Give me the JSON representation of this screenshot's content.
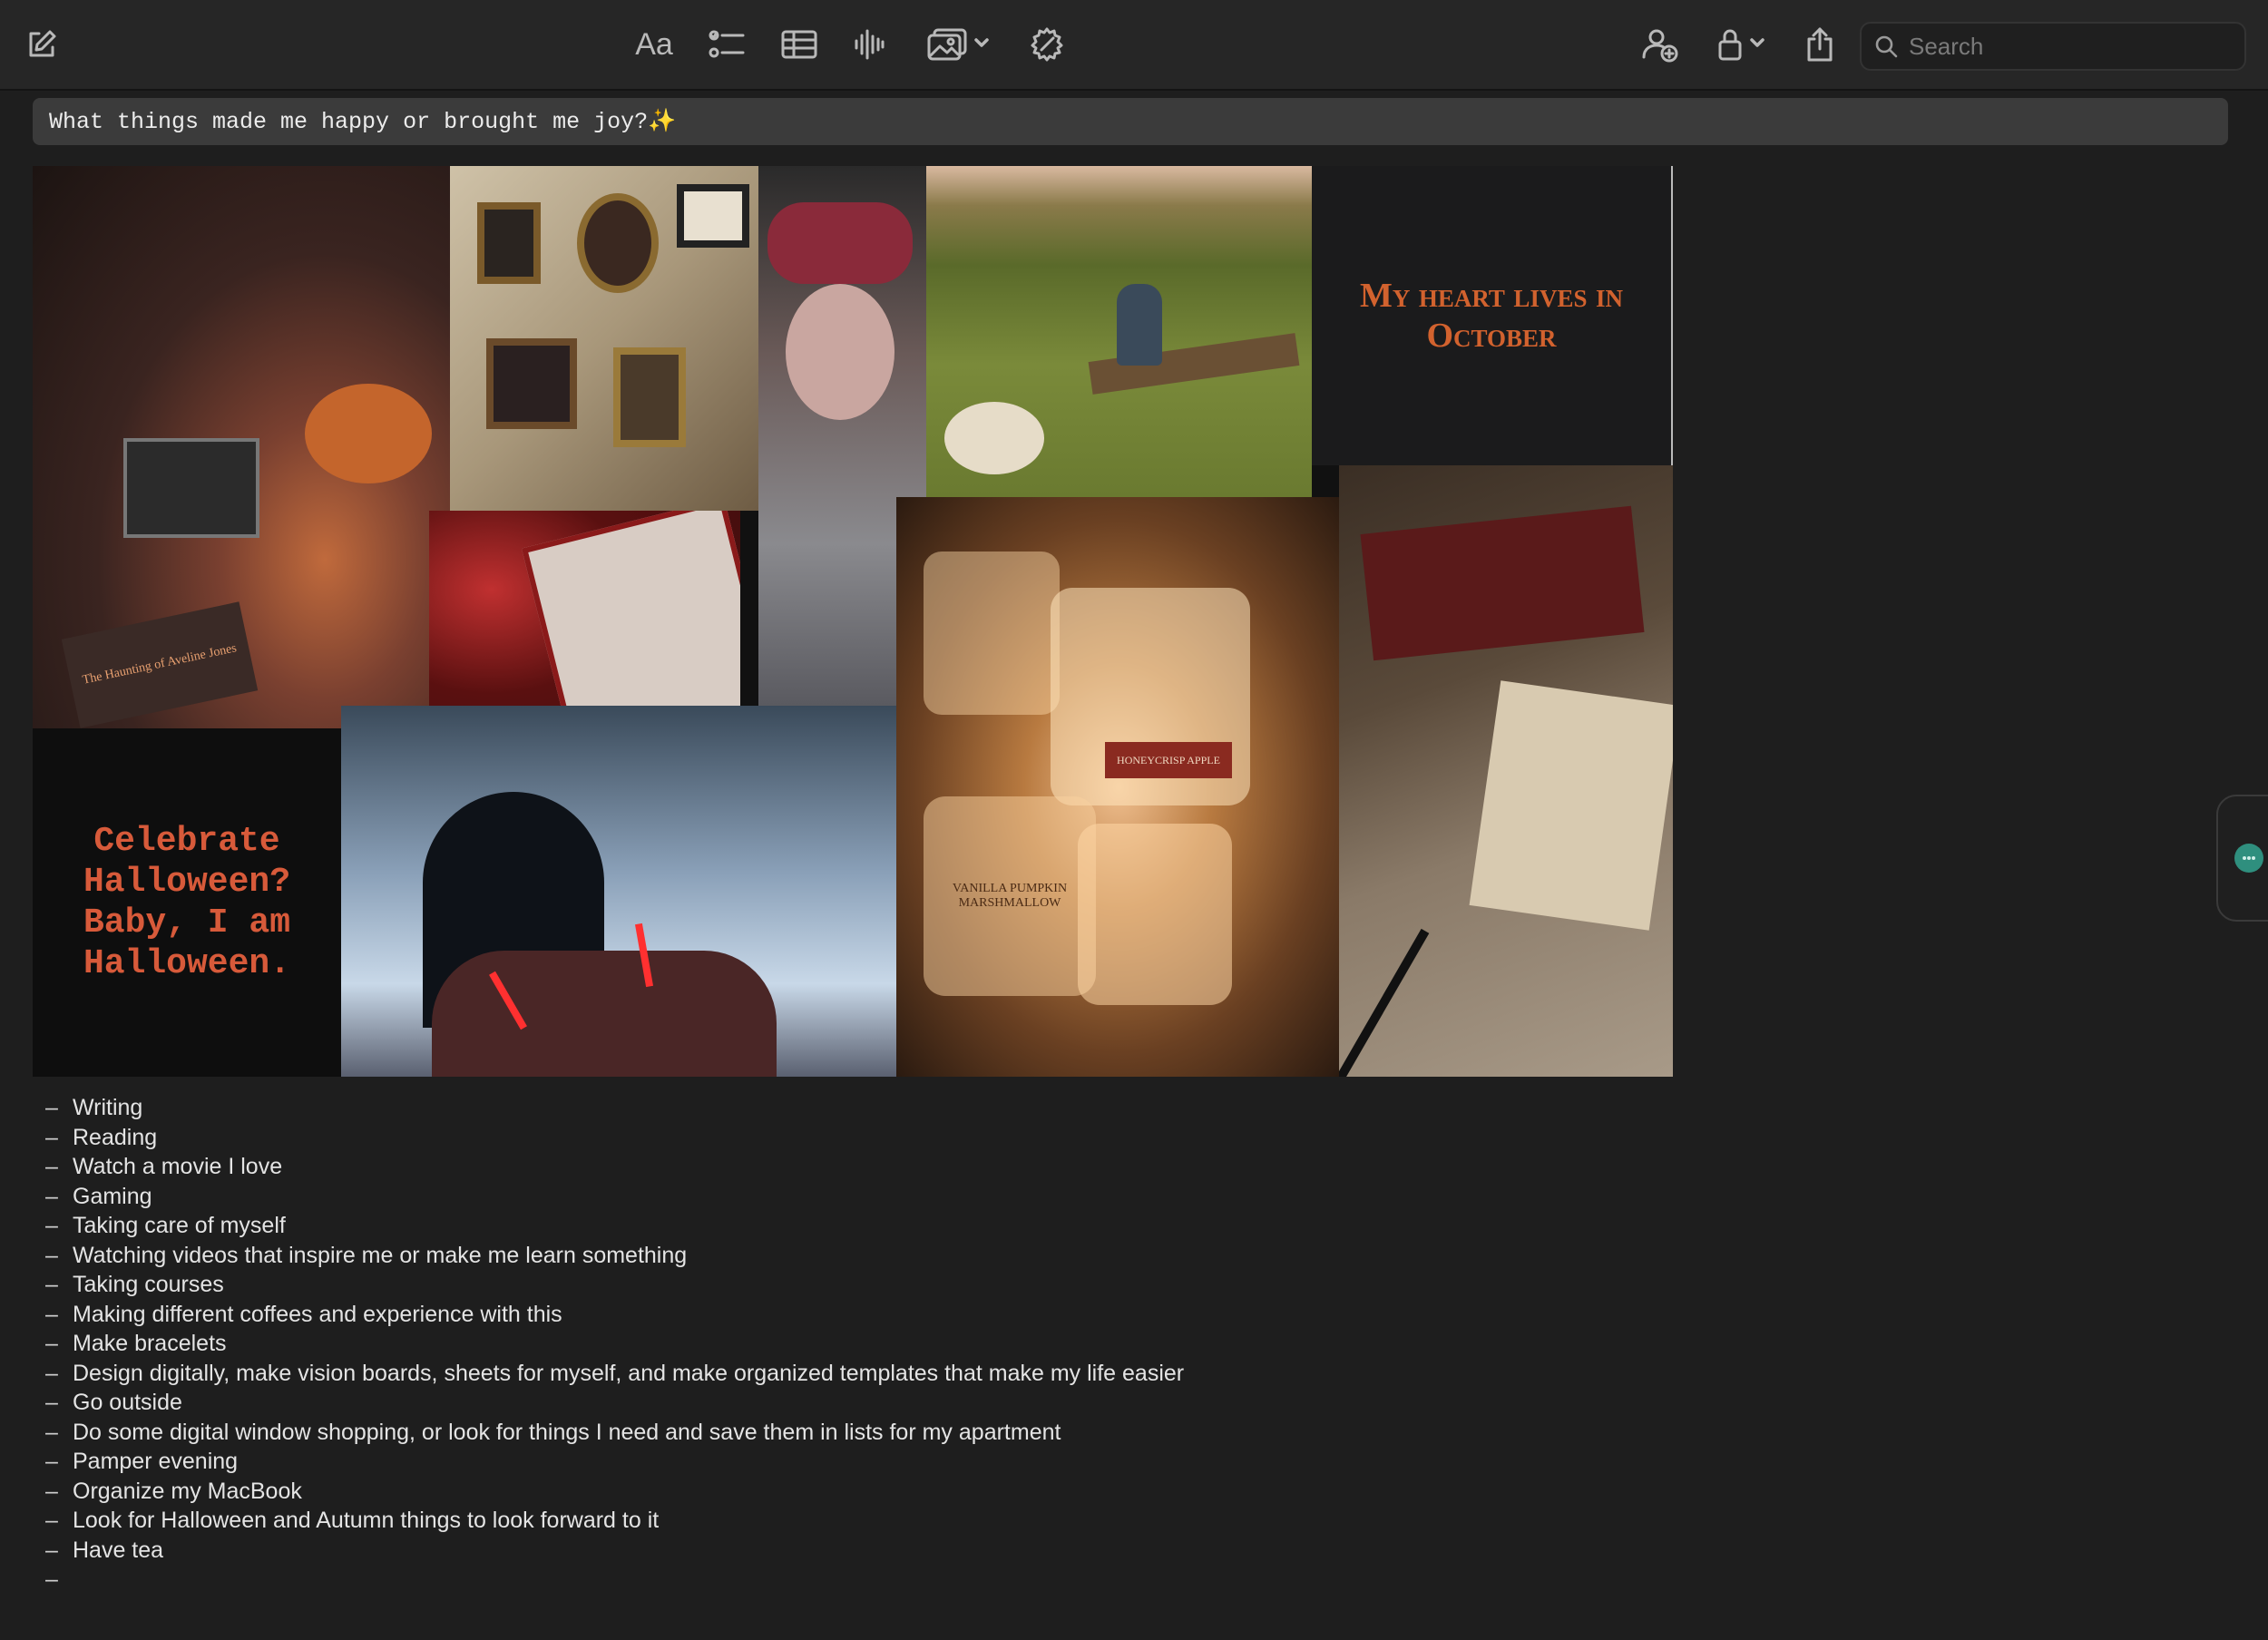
{
  "toolbar": {
    "font_label": "Aa",
    "search_placeholder": "Search"
  },
  "note": {
    "title": "What things made me happy or brought me joy?✨",
    "collage": {
      "october_text": "My heart lives in October",
      "halloween_text": "Celebrate Halloween? Baby, I am Halloween.",
      "candle_label_1": "VANILLA PUMPKIN MARSHMALLOW",
      "candle_label_2": "HONEYCRISP APPLE",
      "book_title": "The Haunting of Aveline Jones"
    },
    "list": [
      "Writing",
      "Reading",
      "Watch a movie I love",
      "Gaming",
      "Taking care of myself",
      "Watching videos that inspire me or make me learn something",
      "Taking courses",
      "Making different coffees and experience with this",
      "Make bracelets",
      "Design digitally, make vision boards, sheets for myself, and make organized templates that make my life easier",
      "Go outside",
      "Do some digital window shopping, or look for things I need and save them in lists for my apartment",
      "Pamper evening",
      "Organize my MacBook",
      "Look for Halloween and Autumn things to look forward to it",
      "Have tea",
      ""
    ]
  },
  "colors": {
    "background": "#1e1e1e",
    "toolbar": "#262626",
    "title_box": "#3b3b3b",
    "accent_orange": "#d2622e",
    "side_dot": "#2f8f7e"
  }
}
